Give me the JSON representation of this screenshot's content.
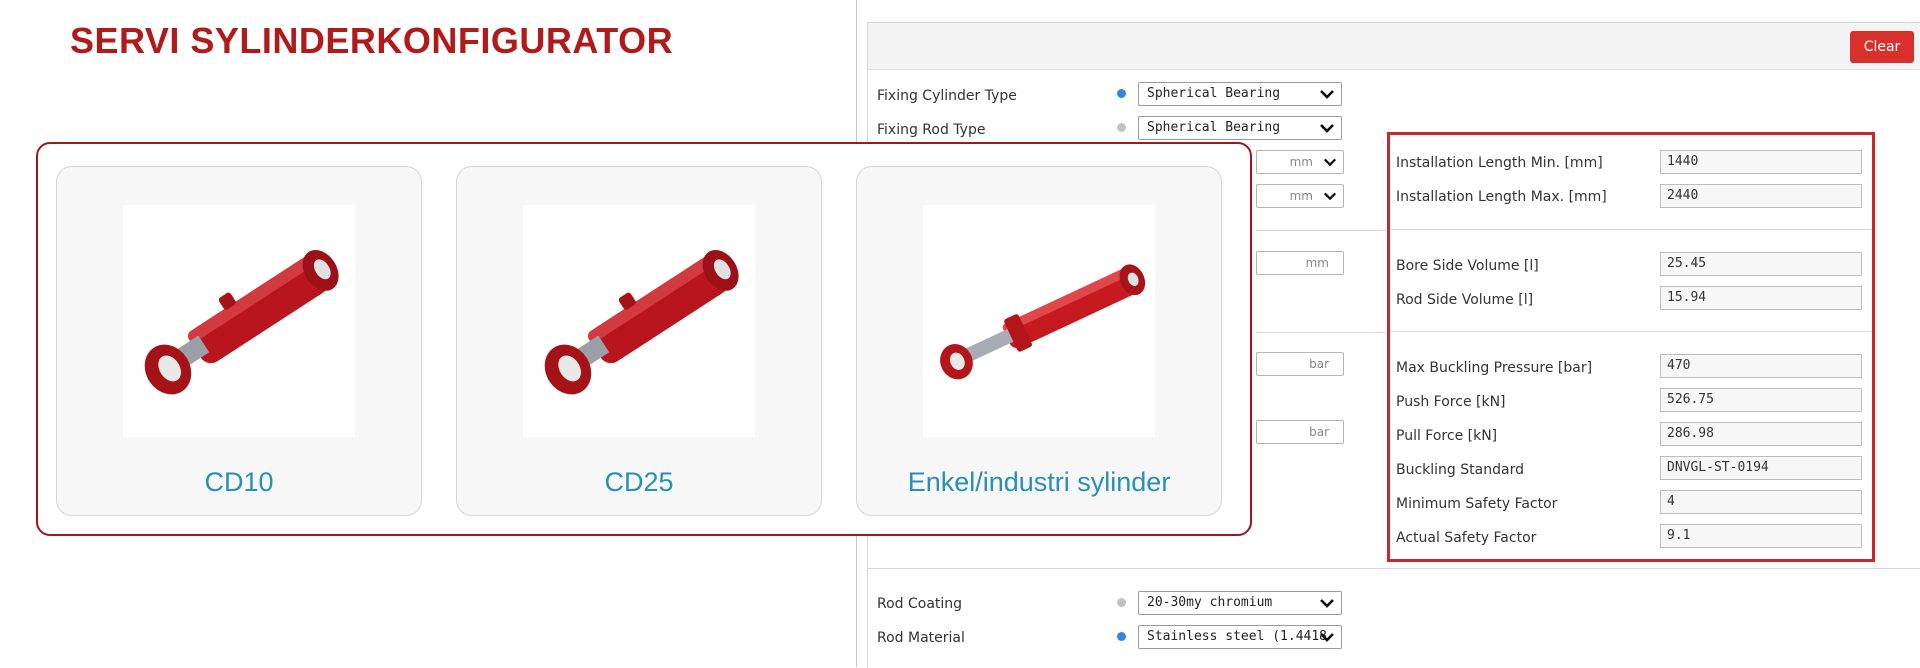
{
  "page": {
    "title": "SERVI SYLINDERKONFIGURATOR"
  },
  "panel": {
    "clear_label": "Clear",
    "fixing_cylinder_type": {
      "label": "Fixing Cylinder Type",
      "value": "Spherical Bearing"
    },
    "fixing_rod_type": {
      "label": "Fixing Rod Type",
      "value": "Spherical Bearing"
    },
    "units": {
      "mm": "mm",
      "bar": "bar"
    },
    "rod_coating": {
      "label": "Rod Coating",
      "value": "20-30my chromium"
    },
    "rod_material": {
      "label": "Rod Material",
      "value": "Stainless steel (1.4418"
    }
  },
  "results": {
    "installation_length_min": {
      "label": "Installation Length Min. [mm]",
      "value": "1440"
    },
    "installation_length_max": {
      "label": "Installation Length Max. [mm]",
      "value": "2440"
    },
    "bore_side_volume": {
      "label": "Bore Side Volume [l]",
      "value": "25.45"
    },
    "rod_side_volume": {
      "label": "Rod Side Volume [l]",
      "value": "15.94"
    },
    "max_buckling_pressure": {
      "label": "Max Buckling Pressure [bar]",
      "value": "470"
    },
    "push_force": {
      "label": "Push Force [kN]",
      "value": "526.75"
    },
    "pull_force": {
      "label": "Pull Force [kN]",
      "value": "286.98"
    },
    "buckling_standard": {
      "label": "Buckling Standard",
      "value": "DNVGL-ST-0194"
    },
    "minimum_safety_factor": {
      "label": "Minimum Safety Factor",
      "value": "4"
    },
    "actual_safety_factor": {
      "label": "Actual Safety Factor",
      "value": "9.1"
    }
  },
  "products": [
    {
      "name": "CD10"
    },
    {
      "name": "CD25"
    },
    {
      "name": "Enkel/industri sylinder"
    }
  ],
  "colors": {
    "brand_red": "#b01a1a",
    "highlight_border": "#c7272d",
    "clear_button": "#d9302b",
    "link_blue": "#2790b8",
    "active_dot": "#2f86e6",
    "inactive_dot": "#c2c2c2"
  },
  "icons": {
    "select_chevron": "chevron-down-icon",
    "status_dot_active": "status-dot-blue",
    "status_dot_inactive": "status-dot-gray"
  }
}
